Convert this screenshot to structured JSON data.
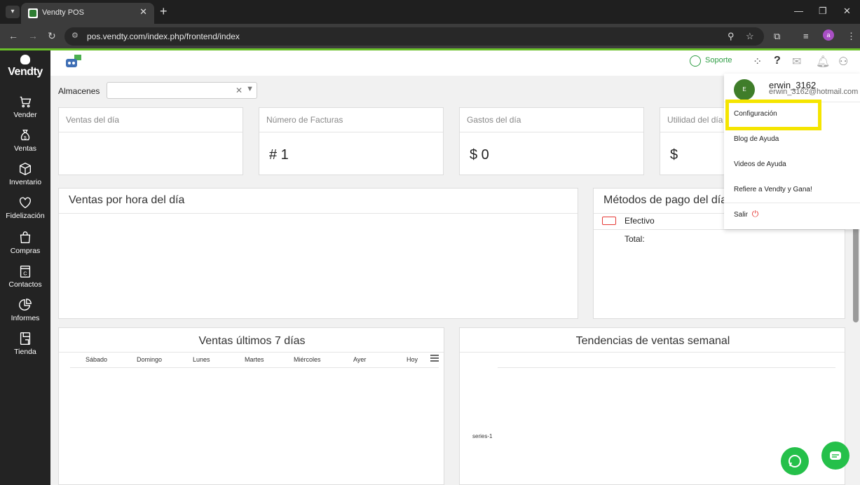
{
  "browser": {
    "tab_title": "Vendty POS",
    "url": "pos.vendty.com/index.php/frontend/index",
    "profile_initial": "a"
  },
  "sidebar": {
    "logo": "Vendty",
    "items": [
      {
        "label": "Vender",
        "icon": "cart-icon"
      },
      {
        "label": "Ventas",
        "icon": "money-bag-icon"
      },
      {
        "label": "Inventario",
        "icon": "box-icon"
      },
      {
        "label": "Fidelización",
        "icon": "heart-icon"
      },
      {
        "label": "Compras",
        "icon": "shopping-bag-icon"
      },
      {
        "label": "Contactos",
        "icon": "contacts-icon"
      },
      {
        "label": "Informes",
        "icon": "pie-chart-icon"
      },
      {
        "label": "Tienda",
        "icon": "store-icon"
      }
    ]
  },
  "header": {
    "soporte": "Soporte"
  },
  "almacenes": {
    "label": "Almacenes"
  },
  "cards": [
    {
      "title": "Ventas del día",
      "value": ""
    },
    {
      "title": "Número de Facturas",
      "value": "# 1"
    },
    {
      "title": "Gastos del día",
      "value": "$ 0"
    },
    {
      "title": "Utilidad del día",
      "value": "$"
    }
  ],
  "panels": {
    "ventas_hora": "Ventas por hora del día",
    "metodos_pago": "Métodos de pago del día",
    "efectivo": "Efectivo",
    "total": "Total:",
    "ultimos7": "Ventas últimos 7 días",
    "tendencias": "Tendencias de ventas semanal",
    "series_label": "series-1"
  },
  "chart_data": {
    "type": "bar",
    "title": "Ventas últimos 7 días",
    "categories": [
      "Sábado",
      "Domingo",
      "Lunes",
      "Martes",
      "Miércoles",
      "Ayer",
      "Hoy"
    ],
    "values": [],
    "xlabel": "",
    "ylabel": ""
  },
  "dropdown": {
    "avatar_initial": "E",
    "username": "erwin_3162",
    "email": "erwin_3162@hotmail.com",
    "items": [
      "Configuración",
      "Blog de Ayuda",
      "Videos de Ayuda",
      "Refiere a Vendty y Gana!",
      "Salir"
    ]
  },
  "colors": {
    "accent_green": "#6abf2a",
    "sidebar": "#232323",
    "highlight": "#f5e500",
    "whatsapp": "#25c04a"
  }
}
